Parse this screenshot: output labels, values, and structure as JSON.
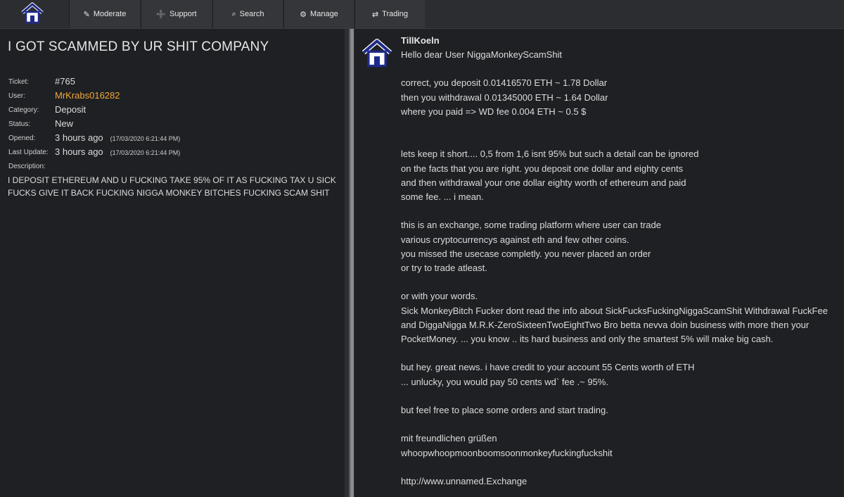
{
  "nav": {
    "logo_icon": "home-icon",
    "items": [
      {
        "label": "Moderate",
        "icon": "user-pen-icon",
        "glyph": "✎"
      },
      {
        "label": "Support",
        "icon": "briefcase-plus-icon",
        "glyph": "➕"
      },
      {
        "label": "Search",
        "icon": "search-icon",
        "glyph": "⌕"
      },
      {
        "label": "Manage",
        "icon": "gear-icon",
        "glyph": "⚙"
      },
      {
        "label": "Trading",
        "icon": "exchange-arrows-icon",
        "glyph": "⇄"
      }
    ]
  },
  "ticket": {
    "title": "I GOT SCAMMED BY UR SHIT COMPANY",
    "fields": {
      "ticket_label": "Ticket:",
      "ticket_value": "#765",
      "user_label": "User:",
      "user_value": "MrKrabs016282",
      "category_label": "Category:",
      "category_value": "Deposit",
      "status_label": "Status:",
      "status_value": "New",
      "opened_label": "Opened:",
      "opened_value": "3 hours ago",
      "opened_exact": "(17/03/2020 6:21:44 PM)",
      "updated_label": "Last Update:",
      "updated_value": "3 hours ago",
      "updated_exact": "(17/03/2020 6:21:44 PM)",
      "description_label": "Description:"
    },
    "description": "I DEPOSIT ETHEREUM AND U FUCKING TAKE 95% OF IT AS FUCKING TAX U SICK FUCKS GIVE IT BACK FUCKING NIGGA MONKEY BITCHES FUCKING SCAM SHIT"
  },
  "reply": {
    "author": "TillKoeln",
    "message": "Hello dear User NiggaMonkeyScamShit\n\ncorrect, you deposit 0.01416570 ETH ~ 1.78 Dollar\nthen you withdrawal 0.01345000 ETH ~ 1.64 Dollar\nwhere you paid => WD fee 0.004 ETH ~ 0.5 $\n\n\nlets keep it short.... 0,5 from 1,6 isnt 95% but such a detail can be ignored\non the facts that you are right. you deposit one dollar and eighty cents\nand then withdrawal your one dollar eighty worth of ethereum and paid\nsome fee. ... i mean.\n\nthis is an exchange, some trading platform where user can trade\nvarious cryptocurrencys against eth and few other coins.\nyou missed the usecase completly. you never placed an order\nor try to trade atleast.\n\nor with your words.\nSick MonkeyBitch Fucker dont read the info about SickFucksFuckingNiggaScamShit Withdrawal FuckFee\nand DiggaNigga M.R.K-ZeroSixteenTwoEightTwo Bro betta nevva doin business with more then your\nPocketMoney. ... you know .. its hard business and only the smartest 5% will make big cash.\n\nbut hey. great news. i have credit to your account 55 Cents worth of ETH\n... unlucky, you would pay 50 cents wd` fee .~ 95%.\n\nbut feel free to place some orders and start trading.\n\nmit freundlichen grüßen\nwhoopwhoopmoonboomsoonmonkeyfuckingfuckshit\n\nhttp://www.unnamed.Exchange"
  },
  "colors": {
    "background": "#1f2023",
    "nav_button": "#34363a",
    "user_link": "#f0a838",
    "logo_blue": "#1f2a8a"
  }
}
